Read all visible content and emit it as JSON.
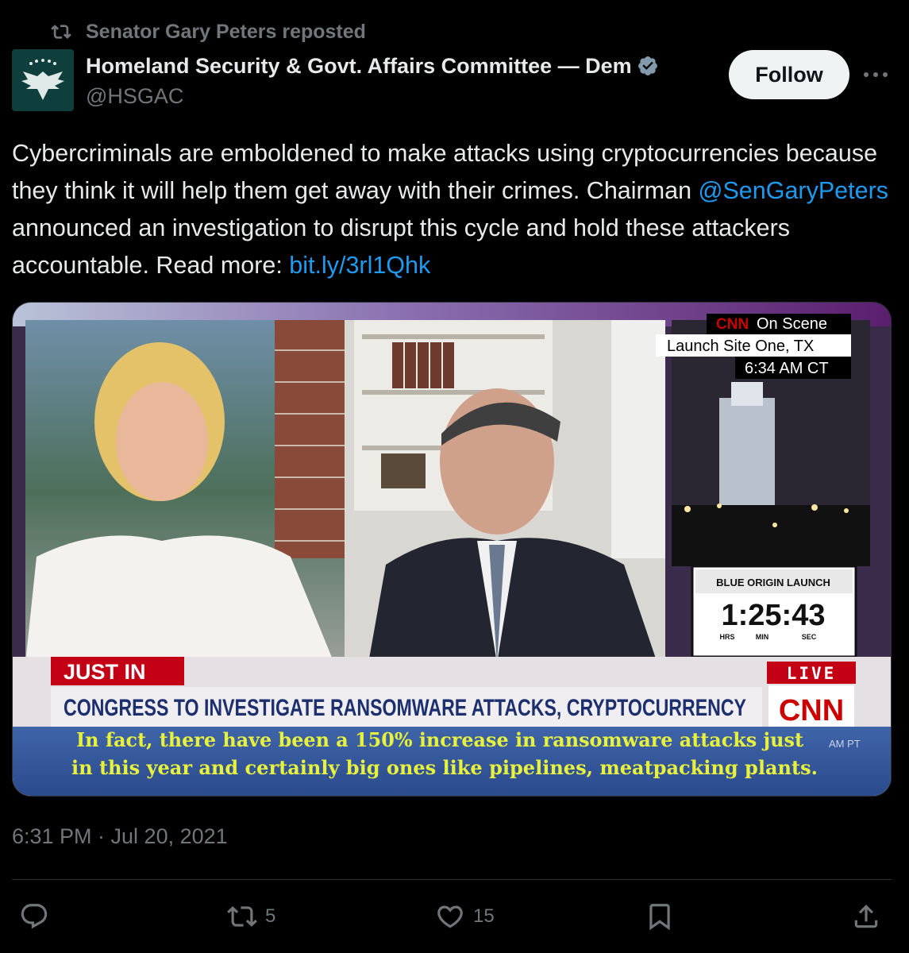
{
  "repost": {
    "label": "Senator Gary Peters reposted",
    "icon": "repost-icon"
  },
  "author": {
    "name": "Homeland Security & Govt. Affairs Committee — Dem",
    "handle": "@HSGAC",
    "verified": true,
    "avatar_icon": "eagle-seal-icon"
  },
  "follow_label": "Follow",
  "tweet": {
    "part1": "Cybercriminals are emboldened to make attacks using cryptocurrencies because they think it will help them get away with their crimes. Chairman ",
    "mention": "@SenGaryPeters",
    "part2": " announced an investigation to disrupt this cycle and hold these attackers accountable. Read more: ",
    "link": "bit.ly/3rl1Qhk"
  },
  "media": {
    "cnn_tag": "CNN",
    "on_scene": "On Scene",
    "location": "Launch Site One, TX",
    "scene_time": "6:34 AM CT",
    "countdown_label": "BLUE ORIGIN LAUNCH",
    "countdown": "1:25:43",
    "countdown_units": [
      "HRS",
      "MIN",
      "SEC"
    ],
    "just_in": "JUST IN",
    "live": "LIVE",
    "headline": "CONGRESS TO INVESTIGATE RANSOMWARE ATTACKS, CRYPTOCURRENCY",
    "network_logo": "CNN",
    "clock": "AM PT",
    "caption_line1": "In fact, there have been a 150% increase in ransomware attacks just",
    "caption_line2": "in this year and certainly big ones like pipelines, meatpacking plants."
  },
  "timestamp": "6:31 PM · Jul 20, 2021",
  "actions": {
    "reply_count": "",
    "repost_count": "5",
    "like_count": "15"
  },
  "colors": {
    "link": "#1d9bf0",
    "muted": "#71767b",
    "cnn_red": "#cc0000",
    "caption_yellow": "#e8f23c"
  }
}
